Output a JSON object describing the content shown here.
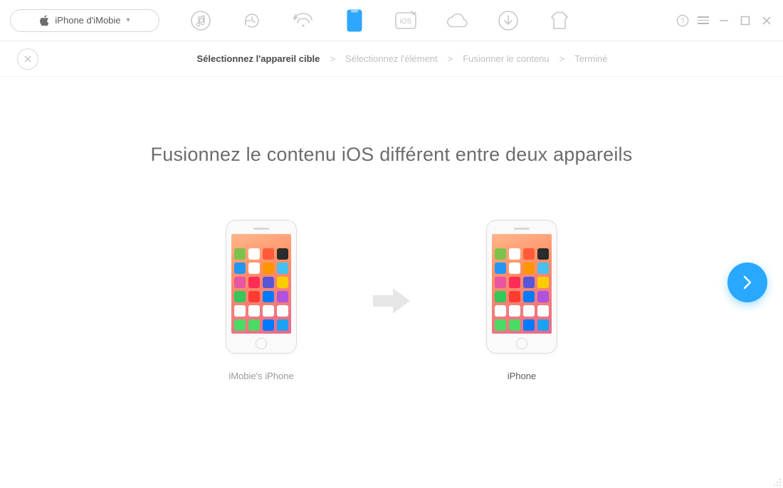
{
  "device_selector": {
    "label": "iPhone d'iMobie"
  },
  "toolbar_icons": {
    "music": "music-icon",
    "history": "history-icon",
    "wifi_refresh": "wifi-refresh-icon",
    "phone": "phone-icon",
    "ios_box": "ios-box-icon",
    "cloud": "cloud-icon",
    "download": "download-circle-icon",
    "shirt": "shirt-icon"
  },
  "breadcrumb": {
    "items": [
      "Sélectionnez l'appareil cible",
      "Sélectionnez l'élément",
      "Fusionner le contenu",
      "Terminé"
    ],
    "active_index": 0,
    "separator": ">"
  },
  "headline": "Fusionnez le contenu iOS différent entre deux appareils",
  "devices": {
    "source": {
      "label": "iMobie's iPhone"
    },
    "target": {
      "label": "iPhone"
    }
  },
  "app_colors": [
    "#7cc24a",
    "#ffffff",
    "#ff5b3a",
    "#2b2b2b",
    "#2196f3",
    "#ffffff",
    "#ff9500",
    "#46c0ef",
    "#e755a3",
    "#ff2d55",
    "#5856d6",
    "#ffcc00",
    "#34c759",
    "#ff3b30",
    "#007aff",
    "#af52de",
    "#ffffff",
    "#ffffff",
    "#ffffff",
    "#ffffff",
    "#4cd964",
    "#4cd964",
    "#007aff",
    "#1da1f2"
  ]
}
